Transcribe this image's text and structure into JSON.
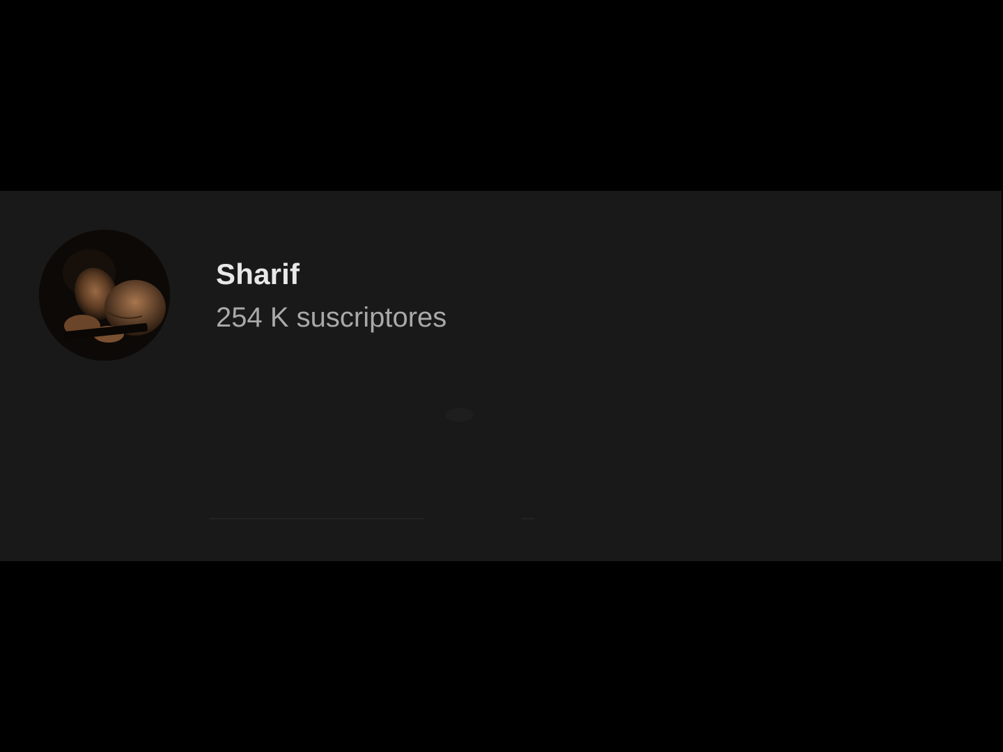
{
  "channel": {
    "name": "Sharif",
    "subscribers": "254 K suscriptores",
    "avatar_icon": "channel-avatar-photo"
  },
  "colors": {
    "page_background": "#000000",
    "panel_background": "#191919",
    "name_text": "#e8e8e8",
    "subscriber_text": "#a9a9a9"
  }
}
